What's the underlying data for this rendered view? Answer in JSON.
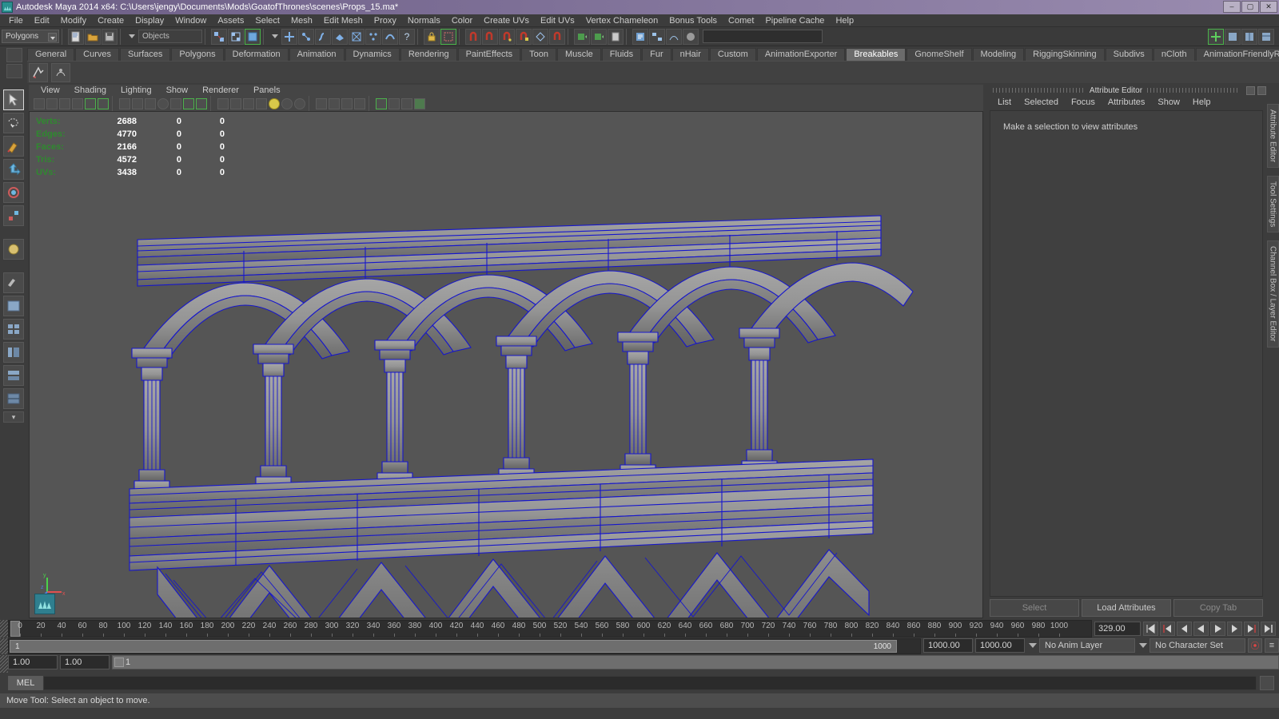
{
  "window": {
    "title": "Autodesk Maya 2014 x64: C:\\Users\\jengy\\Documents\\Mods\\GoatofThrones\\scenes\\Props_15.ma*",
    "minimize": "–",
    "maximize": "▢",
    "close": "✕"
  },
  "menubar": {
    "items": [
      "File",
      "Edit",
      "Modify",
      "Create",
      "Display",
      "Window",
      "Assets",
      "Select",
      "Mesh",
      "Edit Mesh",
      "Proxy",
      "Normals",
      "Color",
      "Create UVs",
      "Edit UVs",
      "Vertex Chameleon",
      "Bonus Tools",
      "Comet",
      "Pipeline Cache",
      "Help"
    ]
  },
  "statusline": {
    "mode": "Polygons",
    "object_field": "Objects",
    "search_placeholder": ""
  },
  "shelf": {
    "tabs": [
      "General",
      "Curves",
      "Surfaces",
      "Polygons",
      "Deformation",
      "Animation",
      "Dynamics",
      "Rendering",
      "PaintEffects",
      "Toon",
      "Muscle",
      "Fluids",
      "Fur",
      "nHair",
      "Custom",
      "AnimationExporter",
      "Breakables",
      "GnomeShelf",
      "Modeling",
      "RiggingSkinning",
      "Subdivs",
      "nCloth",
      "AnimationFriendlyRigging"
    ],
    "active_tab": "Breakables"
  },
  "viewport": {
    "menus": [
      "View",
      "Shading",
      "Lighting",
      "Show",
      "Renderer",
      "Panels"
    ],
    "hud": {
      "rows": [
        {
          "label": "Verts:",
          "total": "2688",
          "selected": "0",
          "other": "0"
        },
        {
          "label": "Edges:",
          "total": "4770",
          "selected": "0",
          "other": "0"
        },
        {
          "label": "Faces:",
          "total": "2166",
          "selected": "0",
          "other": "0"
        },
        {
          "label": "Tris:",
          "total": "4572",
          "selected": "0",
          "other": "0"
        },
        {
          "label": "UVs:",
          "total": "3438",
          "selected": "0",
          "other": "0"
        }
      ]
    },
    "axis": {
      "y": "y",
      "x": "x",
      "z": "z"
    },
    "scene_colors": {
      "background": "#555555",
      "wireframe": "#1414c8",
      "surface": "#9a9a9a",
      "surface_shadow": "#6e6e6e"
    }
  },
  "attribute_editor": {
    "title": "Attribute Editor",
    "menus": [
      "List",
      "Selected",
      "Focus",
      "Attributes",
      "Show",
      "Help"
    ],
    "hint": "Make a selection to view attributes",
    "buttons": [
      {
        "label": "Select",
        "enabled": false
      },
      {
        "label": "Load Attributes",
        "enabled": true
      },
      {
        "label": "Copy Tab",
        "enabled": false
      }
    ]
  },
  "right_tabs": [
    "Attribute Editor",
    "Tool Settings",
    "Channel Box / Layer Editor"
  ],
  "timeline": {
    "ticks": [
      "0",
      "20",
      "40",
      "60",
      "80",
      "100",
      "120",
      "140",
      "160",
      "180",
      "200",
      "220",
      "240",
      "260",
      "280",
      "300",
      "320",
      "340",
      "360",
      "380",
      "400",
      "420",
      "440",
      "460",
      "480",
      "500",
      "520",
      "540",
      "560",
      "580",
      "600",
      "620",
      "640",
      "660",
      "680",
      "700",
      "720",
      "740",
      "760",
      "780",
      "800",
      "820",
      "840",
      "860",
      "880",
      "900",
      "920",
      "940",
      "960",
      "980",
      "1000"
    ],
    "current_frame_field": "329.00",
    "current_frame_marker": "0"
  },
  "range": {
    "start": "1.00",
    "end": "1.00",
    "playback_value": "1",
    "range_end_label": "1000",
    "anim_start": "1000.00",
    "anim_end": "1000.00",
    "anim_layer": "No Anim Layer",
    "character_set": "No Character Set"
  },
  "mel": {
    "label": "MEL",
    "command": ""
  },
  "help": {
    "text": "Move Tool: Select an object to move."
  }
}
